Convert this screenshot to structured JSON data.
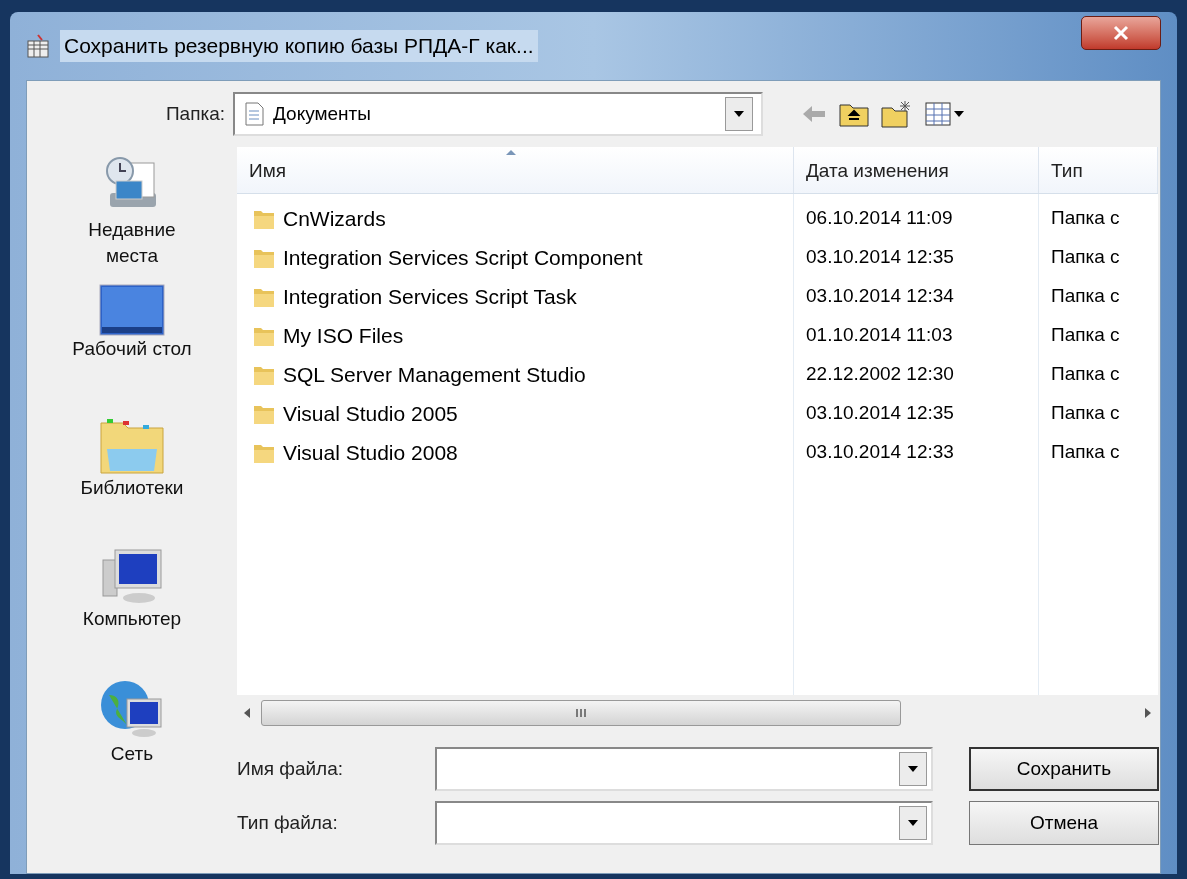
{
  "window": {
    "title": "Сохранить резервную копию базы РПДА-Г как..."
  },
  "folder": {
    "label": "Папка:",
    "value": "Документы"
  },
  "places": [
    {
      "kind": "recent",
      "label": "Недавние места"
    },
    {
      "kind": "desktop",
      "label": "Рабочий стол"
    },
    {
      "kind": "libraries",
      "label": "Библиотеки"
    },
    {
      "kind": "computer",
      "label": "Компьютер"
    },
    {
      "kind": "network",
      "label": "Сеть"
    }
  ],
  "table": {
    "columns": [
      "Имя",
      "Дата изменения",
      "Тип"
    ],
    "rows": [
      {
        "name": "CnWizards",
        "date": "06.10.2014 11:09",
        "type": "Папка с"
      },
      {
        "name": "Integration Services Script Component",
        "date": "03.10.2014 12:35",
        "type": "Папка с"
      },
      {
        "name": "Integration Services Script Task",
        "date": "03.10.2014 12:34",
        "type": "Папка с"
      },
      {
        "name": "My ISO Files",
        "date": "01.10.2014 11:03",
        "type": "Папка с"
      },
      {
        "name": "SQL Server Management Studio",
        "date": "22.12.2002 12:30",
        "type": "Папка с"
      },
      {
        "name": "Visual Studio 2005",
        "date": "03.10.2014 12:35",
        "type": "Папка с"
      },
      {
        "name": "Visual Studio 2008",
        "date": "03.10.2014 12:33",
        "type": "Папка с"
      }
    ]
  },
  "file_name": {
    "label": "Имя файла:"
  },
  "file_type": {
    "label": "Тип файла:"
  },
  "buttons": [
    "Сохранить",
    "Отмена"
  ]
}
